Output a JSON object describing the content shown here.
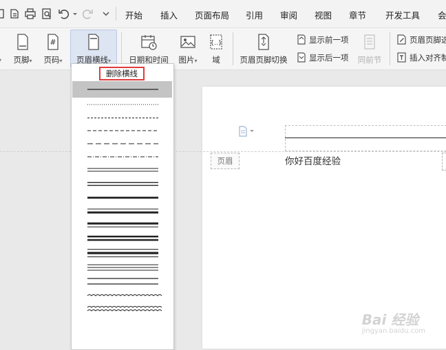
{
  "menu_tabs": [
    "开始",
    "插入",
    "页面布局",
    "引用",
    "审阅",
    "视图",
    "章节",
    "开发工具",
    "会"
  ],
  "ribbon": {
    "footer": "页脚",
    "page_number": "页码",
    "header_line": "页眉横线",
    "date_time": "日期和时间",
    "picture": "图片",
    "field": "域",
    "header_footer_switch": "页眉页脚切换",
    "show_prev": "显示前一项",
    "show_next": "显示后一项",
    "same_as_prev": "同前节",
    "header_footer_options": "页眉页脚选",
    "insert_align_tab": "插入对齐制"
  },
  "dropdown": {
    "delete_line": "删除横线",
    "line_styles": [
      "thin-solid",
      "dotted-fine",
      "dash-short",
      "dash-medium",
      "dash-long",
      "dash-dot",
      "double-thin",
      "double-medium",
      "thick-solid",
      "thin-thick",
      "thick-thin",
      "thick-double",
      "triple-mixed",
      "triple-thin",
      "double-spaced",
      "wavy",
      "double-wavy"
    ]
  },
  "document": {
    "header_tag": "页眉",
    "body_text": "你好百度经验"
  },
  "watermark": {
    "logo": "Bai 经验",
    "url": "jingyan.baidu.com"
  }
}
